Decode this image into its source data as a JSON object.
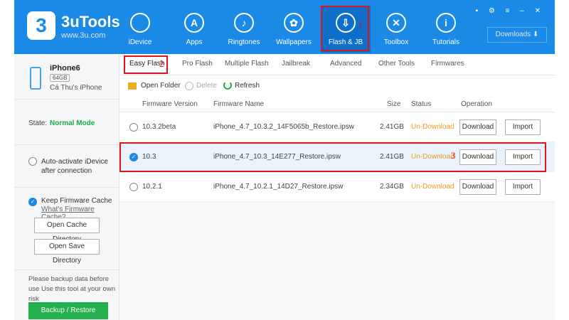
{
  "app": {
    "title": "3uTools",
    "url": "www.3u.com",
    "logo_glyph": "3"
  },
  "nav": [
    {
      "label": "iDevice",
      "icon": "apple-icon",
      "glyph": ""
    },
    {
      "label": "Apps",
      "icon": "apps-icon",
      "glyph": "A"
    },
    {
      "label": "Ringtones",
      "icon": "bell-icon",
      "glyph": "♪"
    },
    {
      "label": "Wallpapers",
      "icon": "wallpaper-icon",
      "glyph": "✿"
    },
    {
      "label": "Flash & JB",
      "icon": "flash-icon",
      "glyph": "⇩"
    },
    {
      "label": "Toolbox",
      "icon": "toolbox-icon",
      "glyph": "✕"
    },
    {
      "label": "Tutorials",
      "icon": "info-icon",
      "glyph": "i"
    }
  ],
  "active_nav": "Flash & JB",
  "window_controls": "▪ ⚙ ≡ – ✕",
  "downloads": {
    "label": "Downloads ⬇"
  },
  "marks": {
    "one": "1",
    "two": "2",
    "three": "3"
  },
  "device": {
    "name": "iPhone6",
    "capacity": "64GB",
    "owner": "Cá Thu's iPhone"
  },
  "state": {
    "label": "State:",
    "value": "Normal Mode"
  },
  "auto_activate": {
    "label": "Auto-activate iDevice after connection"
  },
  "cache": {
    "label": "Keep Firmware Cache",
    "link": "What's Firmware Cache?",
    "open_cache": "Open Cache Directory",
    "open_save": "Open Save Directory"
  },
  "warning": "Please backup data before use Use this tool at your own risk",
  "backup_button": "Backup / Restore",
  "tabs": [
    "Easy Flash",
    "Pro Flash",
    "Multiple Flash",
    "Jailbreak",
    "Advanced",
    "Other Tools",
    "Firmwares"
  ],
  "toolbar": {
    "open_folder": "Open Folder",
    "delete": "Delete",
    "refresh": "Refresh"
  },
  "columns": {
    "version": "Firmware Version",
    "name": "Firmware Name",
    "size": "Size",
    "status": "Status",
    "operation": "Operation"
  },
  "rows": [
    {
      "version": "10.3.2beta",
      "name": "iPhone_4.7_10.3.2_14F5065b_Restore.ipsw",
      "size": "2.41GB",
      "status": "Un-Download",
      "download": "Download",
      "import": "Import",
      "selected": false
    },
    {
      "version": "10.3",
      "name": "iPhone_4.7_10.3_14E277_Restore.ipsw",
      "size": "2.41GB",
      "status": "Un-Download",
      "download": "Download",
      "import": "Import",
      "selected": true
    },
    {
      "version": "10.2.1",
      "name": "iPhone_4.7_10.2.1_14D27_Restore.ipsw",
      "size": "2.34GB",
      "status": "Un-Download",
      "download": "Download",
      "import": "Import",
      "selected": false
    }
  ],
  "colors": {
    "header": "#1a8ae6",
    "annotation": "#e0151b",
    "status": "#f39a1e",
    "state": "#1aaa4c",
    "backup": "#24b04c"
  }
}
